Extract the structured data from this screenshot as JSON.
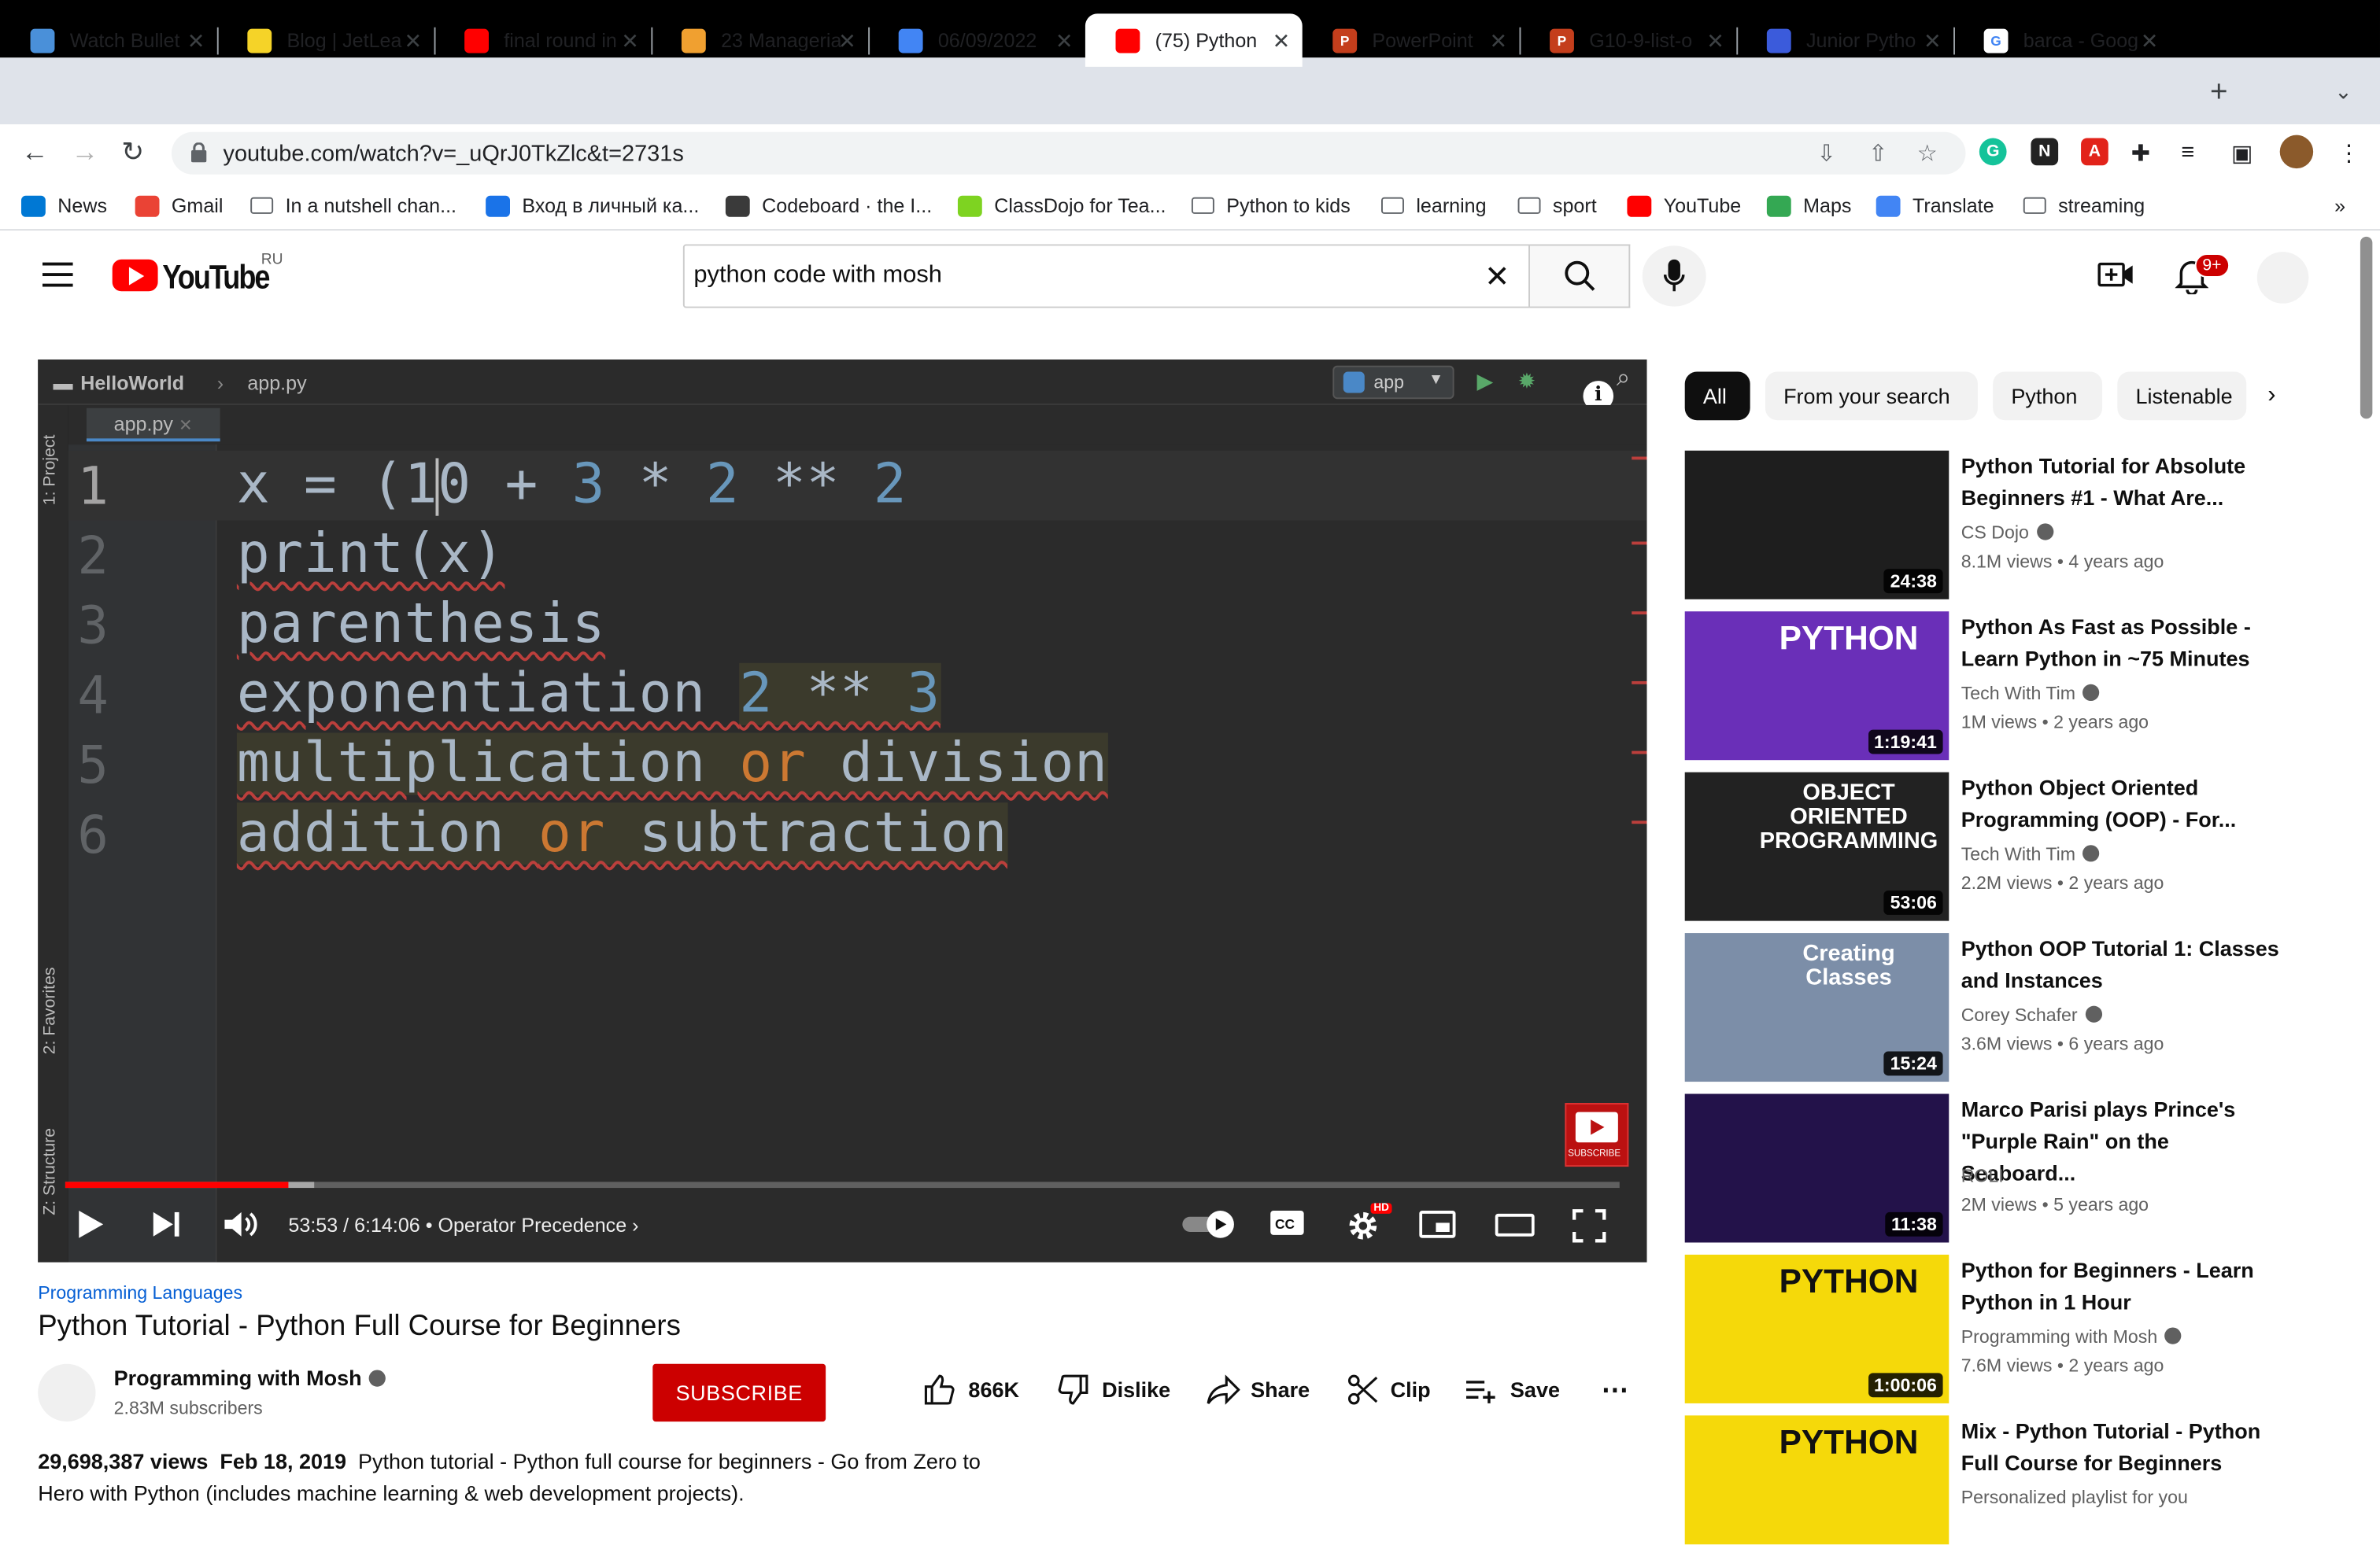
{
  "browser": {
    "tabs": [
      {
        "title": "Watch Bullet",
        "color": "#4a90d9",
        "glyph": ""
      },
      {
        "title": "Blog | JetLea",
        "color": "#f5d328",
        "glyph": ""
      },
      {
        "title": "final round in",
        "color": "#ff0000",
        "glyph": ""
      },
      {
        "title": "23 Manageria",
        "color": "#f0a030",
        "glyph": ""
      },
      {
        "title": "06/09/2022",
        "color": "#4285f4",
        "glyph": ""
      },
      {
        "title": "(75) Python",
        "color": "#ff0000",
        "glyph": ""
      },
      {
        "title": "PowerPoint",
        "color": "#c43e1c",
        "glyph": "P"
      },
      {
        "title": "G10-9-list-o",
        "color": "#c43e1c",
        "glyph": "P"
      },
      {
        "title": "Junior Pytho",
        "color": "#3b5bdb",
        "glyph": ""
      },
      {
        "title": "barca - Goog",
        "color": "#ffffff",
        "glyph": "G"
      }
    ],
    "url": "youtube.com/watch?v=_uQrJ0TkZlc&t=2731s",
    "bookmarks": [
      {
        "label": "News",
        "icon": "ms-news-icon"
      },
      {
        "label": "Gmail",
        "icon": "gmail-icon"
      },
      {
        "label": "In a nutshell chan...",
        "icon": "folder-icon"
      },
      {
        "label": "Вход в личный ка...",
        "icon": "alpha-icon"
      },
      {
        "label": "Codeboard · the I...",
        "icon": "codeboard-icon"
      },
      {
        "label": "ClassDojo for Tea...",
        "icon": "classdojo-icon"
      },
      {
        "label": "Python to kids",
        "icon": "folder-icon"
      },
      {
        "label": "learning",
        "icon": "folder-icon"
      },
      {
        "label": "sport",
        "icon": "folder-icon"
      },
      {
        "label": "YouTube",
        "icon": "youtube-icon"
      },
      {
        "label": "Maps",
        "icon": "maps-icon"
      },
      {
        "label": "Translate",
        "icon": "translate-icon"
      },
      {
        "label": "streaming",
        "icon": "folder-icon"
      }
    ],
    "more_bookmarks": "»"
  },
  "youtube": {
    "logo_text": "YouTube",
    "region": "RU",
    "search_value": "python code with mosh",
    "notifications_badge": "9+"
  },
  "player": {
    "project": "HelloWorld",
    "file": "app.py",
    "run_config": "app",
    "side_labels": [
      "1: Project",
      "2: Favorites",
      "Z: Structure"
    ],
    "line_numbers": [
      "1",
      "2",
      "3",
      "4",
      "5",
      "6"
    ],
    "code": {
      "l1_a": "x = (1",
      "l1_b": "0 + ",
      "l1_n1": "3",
      "l1_op": " * ",
      "l1_n2": "2",
      "l1_op2": " ** ",
      "l1_n3": "2",
      "l2": "print(x)",
      "l3": "parenthesis",
      "l4_a": "exponentiation ",
      "l4_n1": "2",
      "l4_op": " ** ",
      "l4_n2": "3",
      "l5_a": "multiplication ",
      "l5_k": "or",
      "l5_b": " division",
      "l6_a": "addition ",
      "l6_k": "or",
      "l6_b": " subtraction"
    },
    "watermark": "SUBSCRIBE",
    "current_time": "53:53",
    "duration": "6:14:06",
    "time_text": "53:53 / 6:14:06",
    "chapter": "Operator Precedence",
    "played_fraction": 0.144,
    "buffered_fraction": 0.16,
    "hd_badge": "HD"
  },
  "video": {
    "category": "Programming Languages",
    "title": "Python Tutorial - Python Full Course for Beginners",
    "channel": "Programming with Mosh",
    "subscribers": "2.83M subscribers",
    "subscribe_label": "SUBSCRIBE",
    "likes": "866K",
    "dislike_label": "Dislike",
    "share_label": "Share",
    "clip_label": "Clip",
    "save_label": "Save",
    "views": "29,698,387 views",
    "date": "Feb 18, 2019",
    "description": "Python tutorial - Python full course for beginners - Go from Zero to Hero with Python (includes machine learning & web development projects)."
  },
  "chips": [
    "All",
    "From your search",
    "Python",
    "Listenable"
  ],
  "recommendations": [
    {
      "title": "Python Tutorial for Absolute Beginners #1 - What Are...",
      "channel": "CS Dojo",
      "verified": true,
      "meta": "8.1M views • 4 years ago",
      "duration": "24:38",
      "thumb_bg": "#1e1e1e",
      "thumb_text": ""
    },
    {
      "title": "Python As Fast as Possible - Learn Python in ~75 Minutes",
      "channel": "Tech With Tim",
      "verified": true,
      "meta": "1M views • 2 years ago",
      "duration": "1:19:41",
      "thumb_bg": "#6a2fb8",
      "thumb_text": "PYTHON"
    },
    {
      "title": "Python Object Oriented Programming (OOP) - For...",
      "channel": "Tech With Tim",
      "verified": true,
      "meta": "2.2M views • 2 years ago",
      "duration": "53:06",
      "thumb_bg": "#222",
      "thumb_text": "OBJECT ORIENTED PROGRAMMING"
    },
    {
      "title": "Python OOP Tutorial 1: Classes and Instances",
      "channel": "Corey Schafer",
      "verified": true,
      "meta": "3.6M views • 6 years ago",
      "duration": "15:24",
      "thumb_bg": "#7c8ea8",
      "thumb_text": "Creating Classes"
    },
    {
      "title": "Marco Parisi plays Prince's \"Purple Rain\" on the Seaboard...",
      "channel": "ROLI",
      "verified": false,
      "meta": "2M views • 5 years ago",
      "duration": "11:38",
      "thumb_bg": "#23124a",
      "thumb_text": ""
    },
    {
      "title": "Python for Beginners - Learn Python in 1 Hour",
      "channel": "Programming with Mosh",
      "verified": true,
      "meta": "7.6M views • 2 years ago",
      "duration": "1:00:06",
      "thumb_bg": "#f5d90a",
      "thumb_text": "PYTHON"
    },
    {
      "title": "Mix - Python Tutorial - Python Full Course for Beginners",
      "channel": "Personalized playlist for you",
      "verified": false,
      "meta": "",
      "duration": "",
      "thumb_bg": "#f5d90a",
      "thumb_text": "PYTHON"
    }
  ]
}
